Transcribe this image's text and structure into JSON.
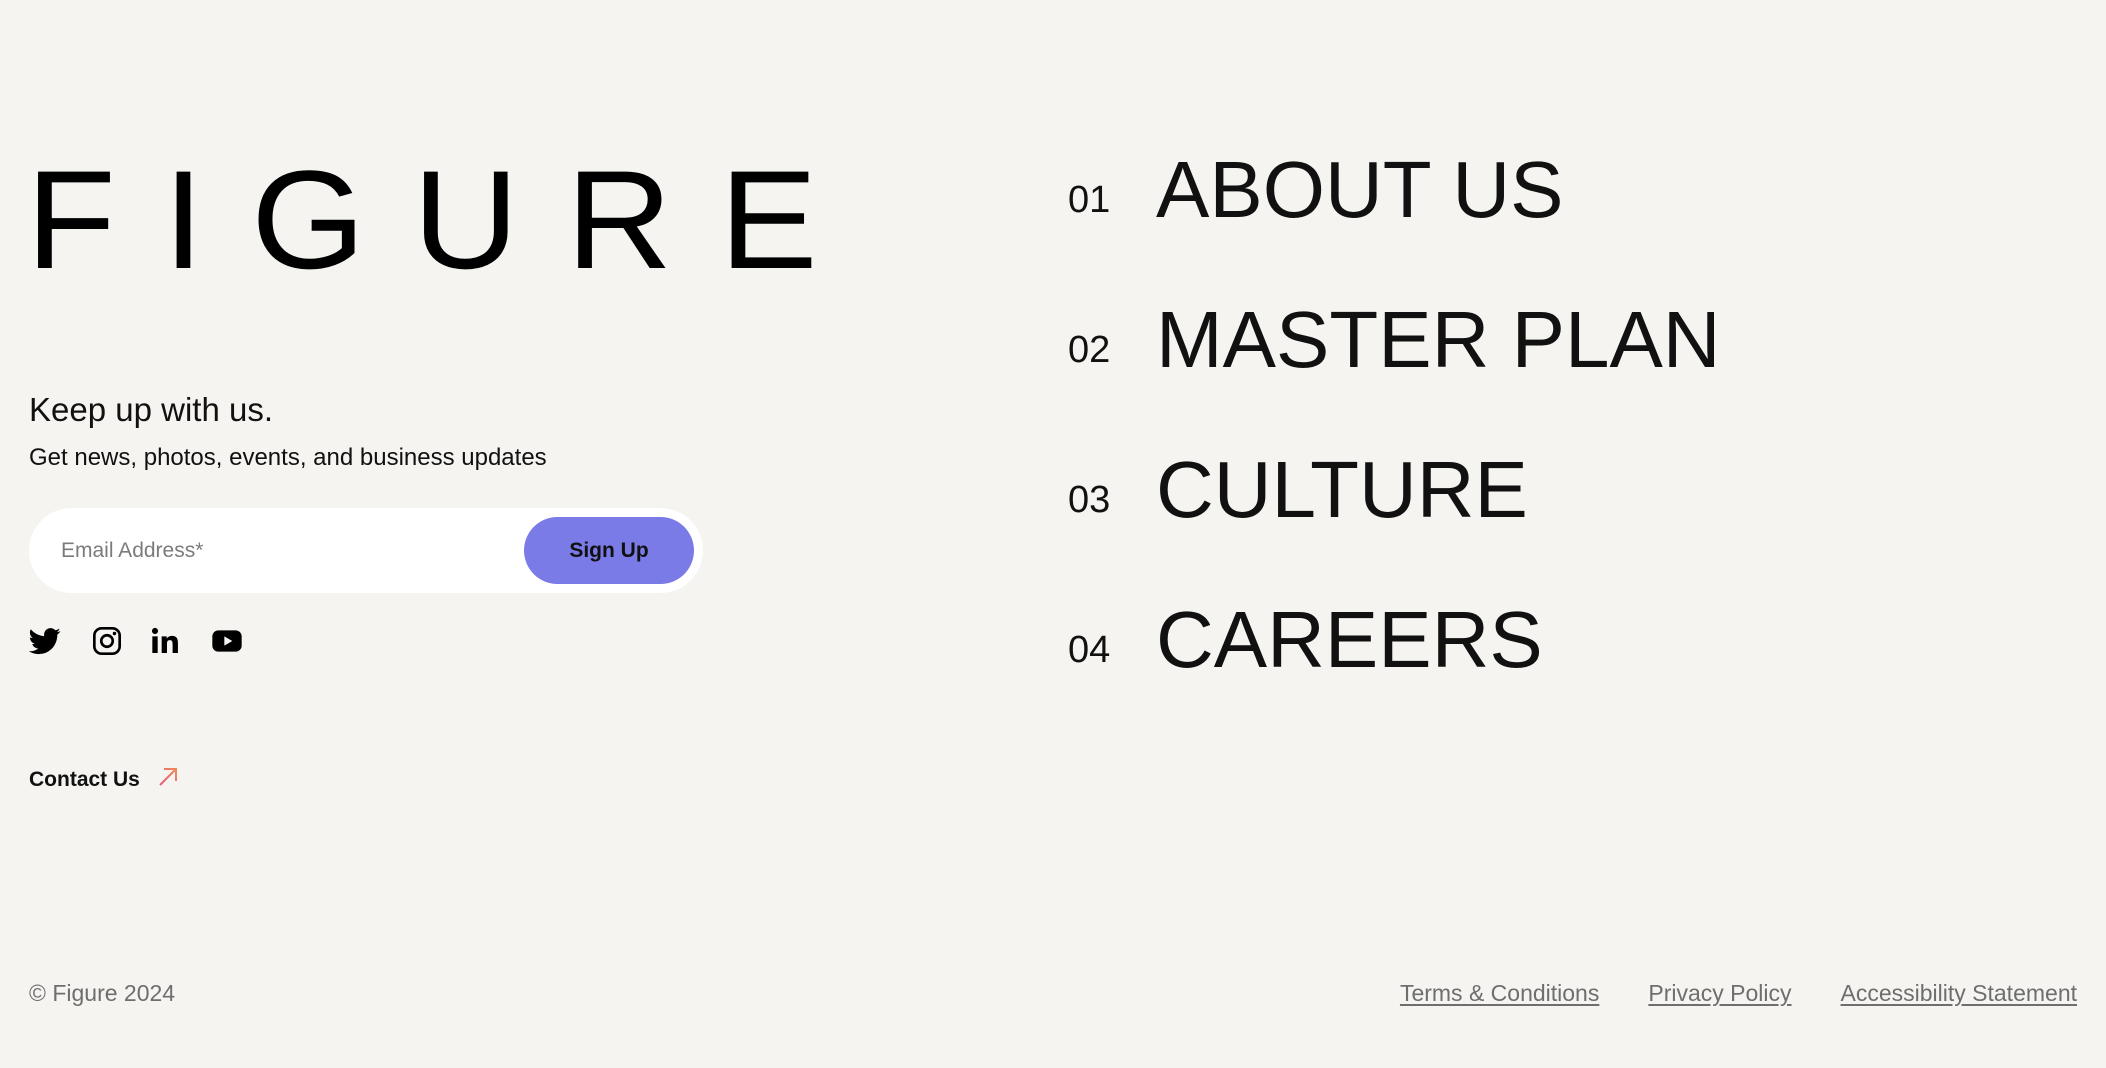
{
  "brand": {
    "logo_text": "FIGURE"
  },
  "newsletter": {
    "heading": "Keep up with us.",
    "subheading": "Get news, photos, events, and business updates",
    "email_placeholder": "Email Address*",
    "email_value": "",
    "submit_label": "Sign Up",
    "accent_color": "#7b7be8"
  },
  "socials": [
    {
      "name": "Twitter",
      "icon": "twitter-icon"
    },
    {
      "name": "Instagram",
      "icon": "instagram-icon"
    },
    {
      "name": "LinkedIn",
      "icon": "linkedin-icon"
    },
    {
      "name": "YouTube",
      "icon": "youtube-icon"
    }
  ],
  "contact": {
    "label": "Contact Us",
    "icon": "arrow-up-right-icon",
    "icon_color": "#e8587a"
  },
  "nav": {
    "items": [
      {
        "number": "01",
        "label": "ABOUT US"
      },
      {
        "number": "02",
        "label": "MASTER PLAN"
      },
      {
        "number": "03",
        "label": "CULTURE"
      },
      {
        "number": "04",
        "label": "CAREERS"
      }
    ]
  },
  "footer": {
    "copyright": "© Figure 2024",
    "links": [
      {
        "label": "Terms & Conditions"
      },
      {
        "label": "Privacy Policy"
      },
      {
        "label": "Accessibility Statement"
      }
    ]
  }
}
